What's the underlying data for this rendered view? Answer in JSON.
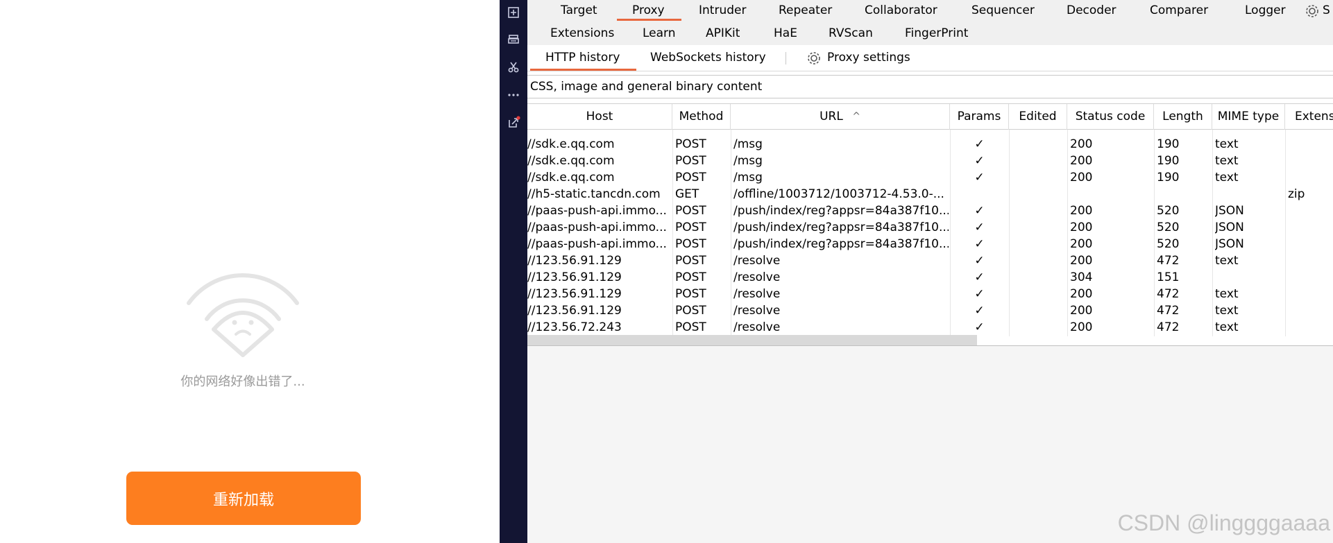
{
  "mobile": {
    "error_text": "你的网络好像出错了...",
    "reload_label": "重新加载",
    "accent_color": "#fd7e1f"
  },
  "sidebar": {
    "icons": [
      "new-window-icon",
      "print-icon",
      "scissors-icon",
      "more-icon",
      "external-link-icon"
    ]
  },
  "tabs_row1": [
    "Target",
    "Proxy",
    "Intruder",
    "Repeater",
    "Collaborator",
    "Sequencer",
    "Decoder",
    "Comparer",
    "Logger"
  ],
  "settings_label": "S",
  "tabs_row2": [
    "Extensions",
    "Learn",
    "APIKit",
    "HaE",
    "RVScan",
    "FingerPrint"
  ],
  "active_tab": "Proxy",
  "sub_tabs": {
    "http_history": "HTTP history",
    "websockets_history": "WebSockets history",
    "proxy_settings": "Proxy settings"
  },
  "filter_text": "CSS, image and general binary content",
  "table": {
    "columns": [
      "Host",
      "Method",
      "URL",
      "Params",
      "Edited",
      "Status code",
      "Length",
      "MIME type",
      "Extensi"
    ],
    "sort_indicator": "^",
    "rows": [
      {
        "host": "//sdk.e.qq.com",
        "method": "POST",
        "url": "/msg",
        "params": "✓",
        "status": "200",
        "length": "190",
        "mime": "text",
        "ext": ""
      },
      {
        "host": "//sdk.e.qq.com",
        "method": "POST",
        "url": "/msg",
        "params": "✓",
        "status": "200",
        "length": "190",
        "mime": "text",
        "ext": ""
      },
      {
        "host": "//sdk.e.qq.com",
        "method": "POST",
        "url": "/msg",
        "params": "✓",
        "status": "200",
        "length": "190",
        "mime": "text",
        "ext": ""
      },
      {
        "host": "//h5-static.tancdn.com",
        "method": "GET",
        "url": "/offline/1003712/1003712-4.53.0-...",
        "params": "",
        "status": "",
        "length": "",
        "mime": "",
        "ext": "zip"
      },
      {
        "host": "//paas-push-api.immo...",
        "method": "POST",
        "url": "/push/index/reg?appsr=84a387f10...",
        "params": "✓",
        "status": "200",
        "length": "520",
        "mime": "JSON",
        "ext": ""
      },
      {
        "host": "//paas-push-api.immo...",
        "method": "POST",
        "url": "/push/index/reg?appsr=84a387f10...",
        "params": "✓",
        "status": "200",
        "length": "520",
        "mime": "JSON",
        "ext": ""
      },
      {
        "host": "//paas-push-api.immo...",
        "method": "POST",
        "url": "/push/index/reg?appsr=84a387f10...",
        "params": "✓",
        "status": "200",
        "length": "520",
        "mime": "JSON",
        "ext": ""
      },
      {
        "host": "//123.56.91.129",
        "method": "POST",
        "url": "/resolve",
        "params": "✓",
        "status": "200",
        "length": "472",
        "mime": "text",
        "ext": ""
      },
      {
        "host": "//123.56.91.129",
        "method": "POST",
        "url": "/resolve",
        "params": "✓",
        "status": "304",
        "length": "151",
        "mime": "",
        "ext": ""
      },
      {
        "host": "//123.56.91.129",
        "method": "POST",
        "url": "/resolve",
        "params": "✓",
        "status": "200",
        "length": "472",
        "mime": "text",
        "ext": ""
      },
      {
        "host": "//123.56.91.129",
        "method": "POST",
        "url": "/resolve",
        "params": "✓",
        "status": "200",
        "length": "472",
        "mime": "text",
        "ext": ""
      },
      {
        "host": "//123.56.72.243",
        "method": "POST",
        "url": "/resolve",
        "params": "✓",
        "status": "200",
        "length": "472",
        "mime": "text",
        "ext": ""
      }
    ]
  },
  "watermark": "CSDN @linggggaaaa",
  "colors": {
    "sidebar": "#131533",
    "active_underline": "#e8683e",
    "reload_button": "#fd7e1f"
  }
}
